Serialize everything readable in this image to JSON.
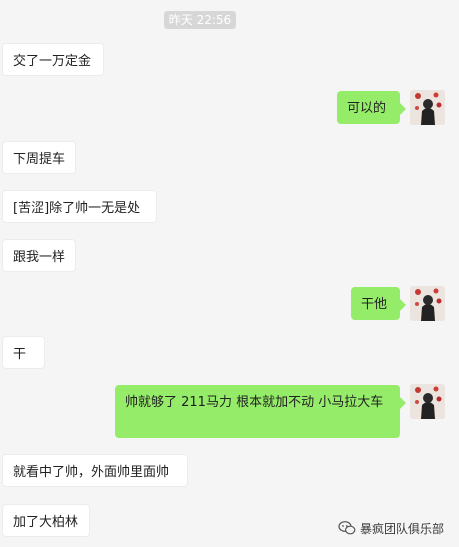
{
  "chat": {
    "timestamp": "昨天 22:56",
    "messages": [
      {
        "text": "交了一万定金"
      },
      {
        "text": "可以的"
      },
      {
        "text": "下周提车"
      },
      {
        "text": "[苦涩]除了帅一无是处"
      },
      {
        "text": "跟我一样"
      },
      {
        "text": "干他"
      },
      {
        "text": "干"
      },
      {
        "text": "帅就够了  211马力 根本就加不动 小马拉大车"
      },
      {
        "text": "就看中了帅，外面帅里面帅"
      },
      {
        "text": "加了大柏林"
      }
    ]
  },
  "watermark": {
    "text": "暴疯团队俱乐部",
    "icon": "wechat-icon"
  },
  "colors": {
    "background": "#f5f5f5",
    "incoming_bubble": "#ffffff",
    "outgoing_bubble": "#95ec69",
    "timestamp_bg": "#d7d7d7"
  }
}
